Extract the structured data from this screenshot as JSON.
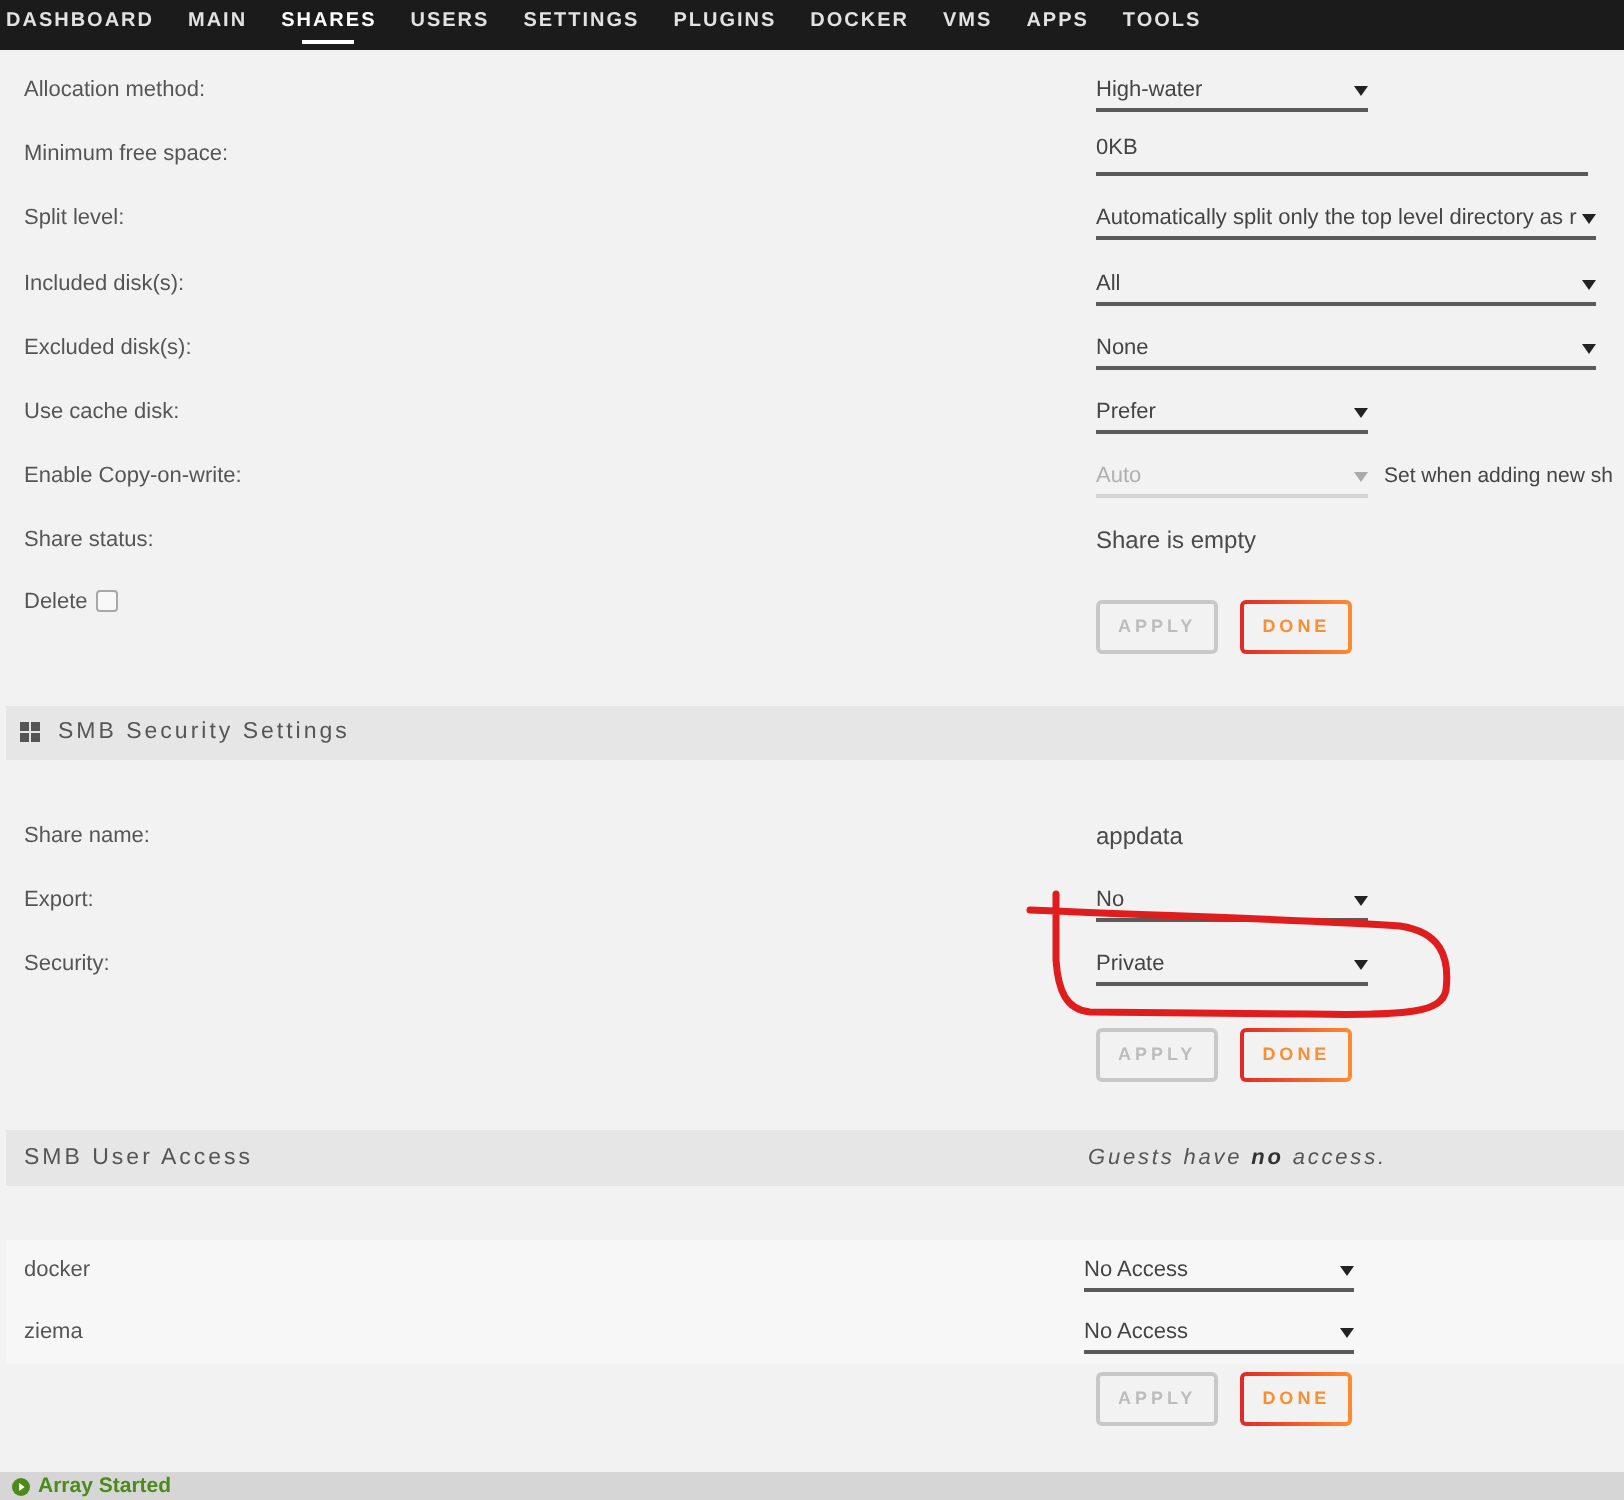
{
  "nav": {
    "tabs": [
      {
        "label": "DASHBOARD",
        "selected": false
      },
      {
        "label": "MAIN",
        "selected": false
      },
      {
        "label": "SHARES",
        "selected": true
      },
      {
        "label": "USERS",
        "selected": false
      },
      {
        "label": "SETTINGS",
        "selected": false
      },
      {
        "label": "PLUGINS",
        "selected": false
      },
      {
        "label": "DOCKER",
        "selected": false
      },
      {
        "label": "VMS",
        "selected": false
      },
      {
        "label": "APPS",
        "selected": false
      },
      {
        "label": "TOOLS",
        "selected": false
      }
    ]
  },
  "share_settings": {
    "fields": [
      {
        "kind": "select",
        "label": "Allocation method:",
        "value": "High-water",
        "disabled": false
      },
      {
        "kind": "input",
        "label": "Minimum free space:",
        "value": "0KB",
        "disabled": false
      },
      {
        "kind": "wide-select",
        "label": "Split level:",
        "value": "Automatically split only the top level directory as r",
        "disabled": false
      },
      {
        "kind": "wide-select",
        "label": "Included disk(s):",
        "value": "All",
        "disabled": false
      },
      {
        "kind": "wide-select",
        "label": "Excluded disk(s):",
        "value": "None",
        "disabled": false
      },
      {
        "kind": "select",
        "label": "Use cache disk:",
        "value": "Prefer",
        "disabled": false
      },
      {
        "kind": "select",
        "label": "Enable Copy-on-write:",
        "value": "Auto",
        "disabled": true,
        "note": "Set when adding new sh"
      }
    ],
    "share_status": {
      "label": "Share status:",
      "value": "Share is empty"
    },
    "delete": {
      "label": "Delete",
      "checked": false
    },
    "buttons": [
      {
        "label": "APPLY",
        "disabled": true
      },
      {
        "label": "DONE",
        "disabled": false
      }
    ]
  },
  "smb_security": {
    "title": "SMB Security Settings",
    "share_name": {
      "label": "Share name:",
      "value": "appdata"
    },
    "fields": [
      {
        "kind": "select",
        "label": "Export:",
        "value": "No",
        "disabled": false
      },
      {
        "kind": "select",
        "label": "Security:",
        "value": "Private",
        "disabled": false
      }
    ],
    "buttons": [
      {
        "label": "APPLY",
        "disabled": true
      },
      {
        "label": "DONE",
        "disabled": false
      }
    ]
  },
  "smb_user_access": {
    "title": "SMB User Access",
    "note": "Guests have **no** access.",
    "users": [
      {
        "name": "docker",
        "access": "No Access"
      },
      {
        "name": "ziema",
        "access": "No Access"
      }
    ],
    "buttons": [
      {
        "label": "APPLY",
        "disabled": true
      },
      {
        "label": "DONE",
        "disabled": false
      }
    ]
  },
  "status_bar": {
    "text": "Array Started"
  }
}
